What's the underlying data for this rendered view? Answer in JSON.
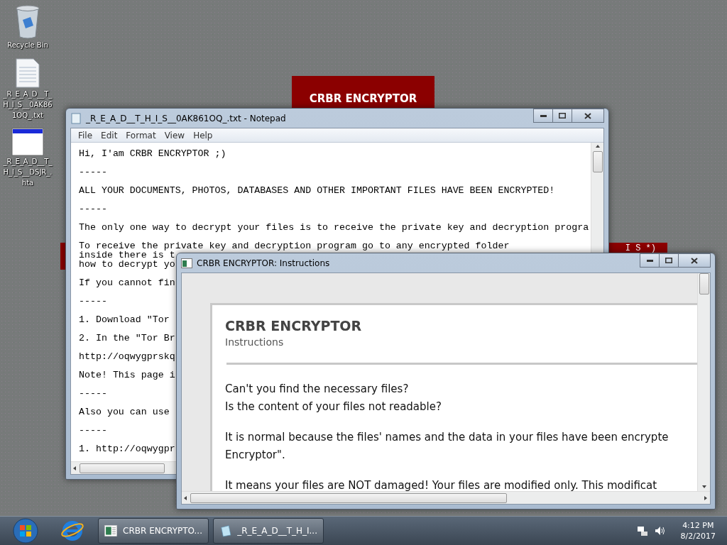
{
  "desktop_icons": [
    {
      "label": "Recycle Bin",
      "kind": "recycle"
    },
    {
      "label": "_R_E_A_D__T_H_I_S__0AK861OQ_.txt",
      "kind": "text"
    },
    {
      "label": "_R_E_A_D__T_H_I_S__DSJR_.hta",
      "kind": "app"
    }
  ],
  "banner": {
    "title": "CRBR ENCRYPTOR"
  },
  "banner_strip": {
    "text": "I S *)"
  },
  "notepad": {
    "title": "_R_E_A_D__T_H_I_S__0AK861OQ_.txt - Notepad",
    "menu": [
      "File",
      "Edit",
      "Format",
      "View",
      "Help"
    ],
    "paragraphs": [
      [
        "Hi, I'am CRBR ENCRYPTOR ;)"
      ],
      [
        "-----"
      ],
      [
        "ALL YOUR DOCUMENTS, PHOTOS, DATABASES AND OTHER IMPORTANT FILES HAVE BEEN ENCRYPTED!"
      ],
      [
        "-----"
      ],
      [
        "The only one way to decrypt your files is to receive the private key and decryption progra"
      ],
      [
        "To receive the private key and decryption program go to any encrypted folder",
        "inside there is t",
        "how to decrypt yo"
      ],
      [
        "If you cannot fin"
      ],
      [
        "-----"
      ],
      [
        "1. Download \"Tor "
      ],
      [
        "2. In the \"Tor Br"
      ],
      [
        "http://oqwygprskq"
      ],
      [
        "Note! This page i"
      ],
      [
        "-----"
      ],
      [
        "Also you can use "
      ],
      [
        "-----"
      ],
      [
        "1. http://oqwygpr"
      ]
    ]
  },
  "instructions_window": {
    "title": "CRBR ENCRYPTOR: Instructions",
    "heading": "CRBR ENCRYPTOR",
    "subheading": "Instructions",
    "paragraphs": [
      [
        "Can't you find the necessary files?",
        "Is the content of your files not readable?"
      ],
      [
        "It is normal because the files' names and the data in your files have been encrypte",
        "Encryptor\"."
      ],
      [
        "It means your files are NOT damaged! Your files are modified only. This modificat"
      ]
    ]
  },
  "taskbar": {
    "tasks": [
      {
        "label": "CRBR ENCRYPTO...",
        "kind": "app"
      },
      {
        "label": "_R_E_A_D__T_H_I...",
        "kind": "notepad"
      }
    ],
    "time": "4:12 PM",
    "date": "8/2/2017"
  }
}
